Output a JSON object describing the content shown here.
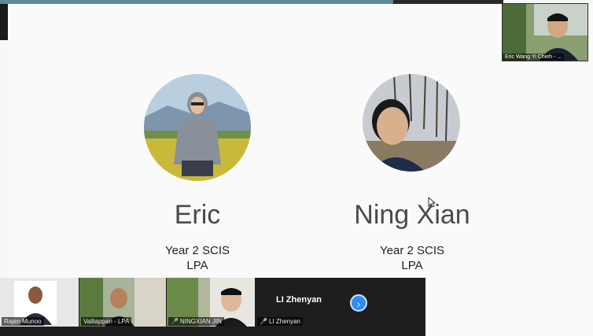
{
  "slide": {
    "people": [
      {
        "name": "Eric",
        "line1": "Year 2 SCIS",
        "line2": "LPA"
      },
      {
        "name": "Ning Xian",
        "line1": "Year 2 SCIS",
        "line2": "LPA"
      }
    ]
  },
  "self_view": {
    "label": "Eric Wang  Yi Chieh - ..."
  },
  "gallery": {
    "tiles": [
      {
        "label": "Rajen Munoo",
        "muted": false
      },
      {
        "label": "Valliappan - LPA",
        "muted": false
      },
      {
        "label": "NINGXIAN JIN",
        "muted": true
      },
      {
        "label": "LI Zhenyan",
        "muted": true
      }
    ],
    "name_only_tile": "LI Zhenyan",
    "next_icon": "chevron-right-icon"
  },
  "colors": {
    "accent": "#2d8cff",
    "mute": "#e53935"
  }
}
